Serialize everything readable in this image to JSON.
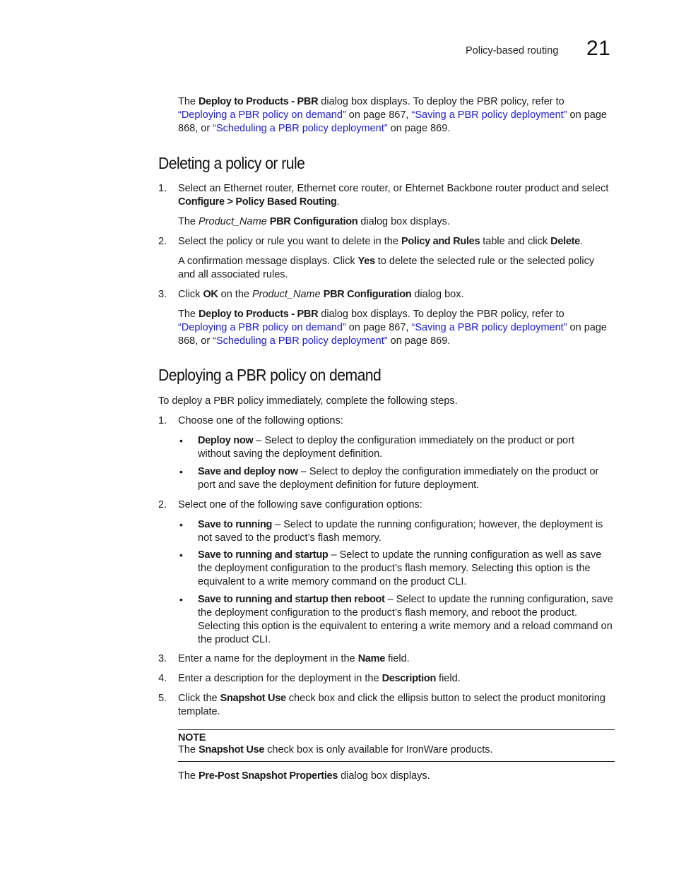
{
  "header": {
    "chapter_title": "Policy-based routing",
    "chapter_number": "21"
  },
  "intro_para": [
    {
      "t": "The "
    },
    {
      "t": "Deploy to Products - PBR",
      "s": "b"
    },
    {
      "t": " dialog box displays. To deploy the PBR policy, refer to "
    },
    {
      "t": "“Deploying a PBR policy on demand”",
      "s": "link"
    },
    {
      "t": " on page 867, "
    },
    {
      "t": "“Saving a PBR policy deployment”",
      "s": "link"
    },
    {
      "t": " on page 868, or "
    },
    {
      "t": "“Scheduling a PBR policy deployment”",
      "s": "link"
    },
    {
      "t": " on page 869."
    }
  ],
  "section1": {
    "title": "Deleting a policy or rule",
    "step1_num": "1.",
    "step1": [
      {
        "t": "Select an Ethernet router, Ethernet core router, or Ehternet Backbone router product and select "
      },
      {
        "t": "Configure > Policy Based Routing",
        "s": "b"
      },
      {
        "t": "."
      }
    ],
    "step1_result": [
      {
        "t": "The "
      },
      {
        "t": "Product_Name",
        "s": "i"
      },
      {
        "t": " "
      },
      {
        "t": "PBR Configuration",
        "s": "b"
      },
      {
        "t": " dialog box displays."
      }
    ],
    "step2_num": "2.",
    "step2": [
      {
        "t": "Select the policy or rule you want to delete in the "
      },
      {
        "t": "Policy and Rules",
        "s": "b"
      },
      {
        "t": " table and click "
      },
      {
        "t": "Delete",
        "s": "b"
      },
      {
        "t": "."
      }
    ],
    "step2_result": [
      {
        "t": "A confirmation message displays. Click "
      },
      {
        "t": "Yes",
        "s": "b"
      },
      {
        "t": " to delete the selected rule or the selected policy and all associated rules."
      }
    ],
    "step3_num": "3.",
    "step3": [
      {
        "t": "Click "
      },
      {
        "t": "OK",
        "s": "b"
      },
      {
        "t": " on the "
      },
      {
        "t": "Product_Name",
        "s": "i"
      },
      {
        "t": " "
      },
      {
        "t": "PBR Configuration",
        "s": "b"
      },
      {
        "t": " dialog box."
      }
    ],
    "step3_result": [
      {
        "t": "The "
      },
      {
        "t": "Deploy to Products - PBR",
        "s": "b"
      },
      {
        "t": " dialog box displays. To deploy the PBR policy, refer to "
      },
      {
        "t": "“Deploying a PBR policy on demand”",
        "s": "link"
      },
      {
        "t": " on page 867, "
      },
      {
        "t": "“Saving a PBR policy deployment”",
        "s": "link"
      },
      {
        "t": " on page 868, or "
      },
      {
        "t": "“Scheduling a PBR policy deployment”",
        "s": "link"
      },
      {
        "t": " on page 869."
      }
    ]
  },
  "section2": {
    "title": "Deploying a PBR policy on demand",
    "intro": [
      {
        "t": "To deploy a PBR policy immediately, complete the following steps."
      }
    ],
    "step1_num": "1.",
    "step1": [
      {
        "t": "Choose one of the following options:"
      }
    ],
    "step1_bullets": [
      [
        {
          "t": "Deploy now",
          "s": "b"
        },
        {
          "t": " – Select to deploy the configuration immediately on the product or port without saving the deployment definition."
        }
      ],
      [
        {
          "t": "Save and deploy now",
          "s": "b"
        },
        {
          "t": " – Select to deploy the configuration immediately on the product or port and save the deployment definition for future deployment."
        }
      ]
    ],
    "step2_num": "2.",
    "step2": [
      {
        "t": "Select one of the following save configuration options:"
      }
    ],
    "step2_bullets": [
      [
        {
          "t": "Save to running",
          "s": "b"
        },
        {
          "t": " – Select to update the running configuration; however, the deployment is not saved to the product’s flash memory."
        }
      ],
      [
        {
          "t": "Save to running and startup",
          "s": "b"
        },
        {
          "t": " – Select to update the running configuration as well as save the deployment configuration to the product’s flash memory. Selecting this option is the equivalent to a write memory command on the product CLI."
        }
      ],
      [
        {
          "t": "Save to running and startup then reboot",
          "s": "b"
        },
        {
          "t": " – Select to update the running configuration, save the deployment configuration to the product’s flash memory, and reboot the product. Selecting this option is the equivalent to entering a write memory and a reload command on the product CLI."
        }
      ]
    ],
    "step3_num": "3.",
    "step3": [
      {
        "t": "Enter a name for the deployment in the "
      },
      {
        "t": "Name",
        "s": "b"
      },
      {
        "t": " field."
      }
    ],
    "step4_num": "4.",
    "step4": [
      {
        "t": "Enter a description for the deployment in the "
      },
      {
        "t": "Description",
        "s": "b"
      },
      {
        "t": " field."
      }
    ],
    "step5_num": "5.",
    "step5": [
      {
        "t": "Click the "
      },
      {
        "t": "Snapshot Use",
        "s": "b"
      },
      {
        "t": " check box and click the ellipsis button to select the product monitoring template."
      }
    ],
    "note_label": "NOTE",
    "note_text": [
      {
        "t": "The "
      },
      {
        "t": "Snapshot Use",
        "s": "b"
      },
      {
        "t": " check box is only available for IronWare products."
      }
    ],
    "step5_result": [
      {
        "t": "The "
      },
      {
        "t": "Pre-Post Snapshot Properties",
        "s": "b"
      },
      {
        "t": " dialog box displays."
      }
    ]
  }
}
